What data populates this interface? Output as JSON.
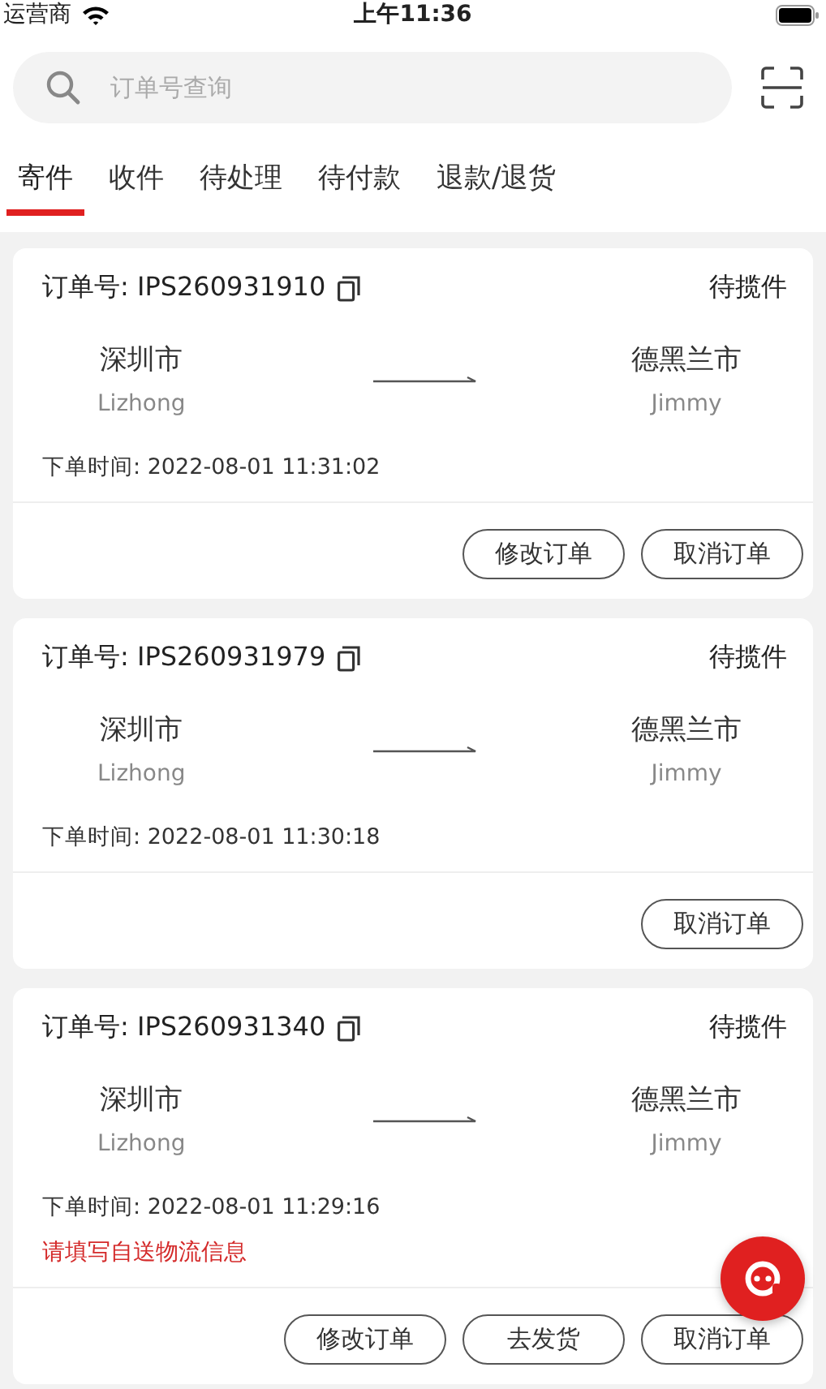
{
  "status_bar": {
    "carrier": "运营商",
    "time": "上午11:36"
  },
  "search": {
    "placeholder": "订单号查询"
  },
  "tabs": [
    {
      "label": "寄件",
      "selected": true
    },
    {
      "label": "收件",
      "selected": false
    },
    {
      "label": "待处理",
      "selected": false
    },
    {
      "label": "待付款",
      "selected": false
    },
    {
      "label": "退款/退货",
      "selected": false
    }
  ],
  "orders": [
    {
      "order_label": "订单号:",
      "order_no": "IPS260931910",
      "status": "待揽件",
      "from_city": "深圳市",
      "from_name": "Lizhong",
      "to_city": "德黑兰市",
      "to_name": "Jimmy",
      "time_label": "下单时间:",
      "time": "2022-08-01 11:31:02",
      "buttons": [
        "修改订单",
        "取消订单"
      ]
    },
    {
      "order_label": "订单号:",
      "order_no": "IPS260931979",
      "status": "待揽件",
      "from_city": "深圳市",
      "from_name": "Lizhong",
      "to_city": "德黑兰市",
      "to_name": "Jimmy",
      "time_label": "下单时间:",
      "time": "2022-08-01 11:30:18",
      "buttons": [
        "取消订单"
      ]
    },
    {
      "order_label": "订单号:",
      "order_no": "IPS260931340",
      "status": "待揽件",
      "from_city": "深圳市",
      "from_name": "Lizhong",
      "to_city": "德黑兰市",
      "to_name": "Jimmy",
      "time_label": "下单时间:",
      "time": "2022-08-01 11:29:16",
      "notice": "请填写自送物流信息",
      "buttons": [
        "修改订单",
        "去发货",
        "取消订单"
      ]
    }
  ]
}
